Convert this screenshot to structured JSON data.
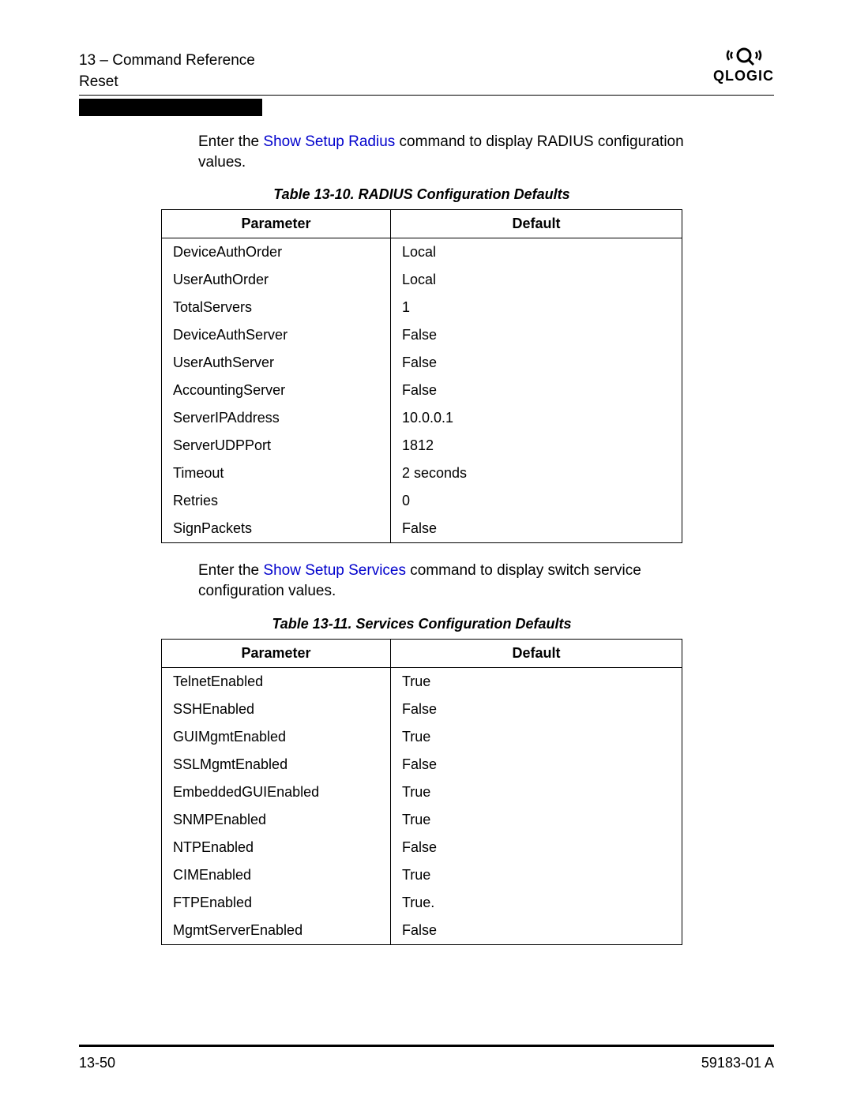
{
  "header": {
    "section": "13 – Command Reference",
    "subsection": "Reset",
    "brand": "QLOGIC"
  },
  "intro1": {
    "pre": "Enter the ",
    "link": "Show Setup Radius",
    "post": " command to display RADIUS configuration values."
  },
  "table1": {
    "caption": "Table 13-10. RADIUS Configuration Defaults",
    "head_param": "Parameter",
    "head_default": "Default"
  },
  "intro2": {
    "pre": "Enter the ",
    "link": "Show Setup Services",
    "post": " command to display switch service configuration values."
  },
  "table2": {
    "caption": "Table 13-11. Services Configuration Defaults",
    "head_param": "Parameter",
    "head_default": "Default"
  },
  "footer": {
    "page": "13-50",
    "docid": "59183-01 A"
  },
  "chart_data": [
    {
      "type": "table",
      "title": "Table 13-10. RADIUS Configuration Defaults",
      "columns": [
        "Parameter",
        "Default"
      ],
      "rows": [
        [
          "DeviceAuthOrder",
          "Local"
        ],
        [
          "UserAuthOrder",
          "Local"
        ],
        [
          "TotalServers",
          "1"
        ],
        [
          "DeviceAuthServer",
          "False"
        ],
        [
          "UserAuthServer",
          "False"
        ],
        [
          "AccountingServer",
          "False"
        ],
        [
          "ServerIPAddress",
          "10.0.0.1"
        ],
        [
          "ServerUDPPort",
          "1812"
        ],
        [
          "Timeout",
          "2 seconds"
        ],
        [
          "Retries",
          "0"
        ],
        [
          "SignPackets",
          "False"
        ]
      ]
    },
    {
      "type": "table",
      "title": "Table 13-11. Services Configuration Defaults",
      "columns": [
        "Parameter",
        "Default"
      ],
      "rows": [
        [
          "TelnetEnabled",
          "True"
        ],
        [
          "SSHEnabled",
          "False"
        ],
        [
          "GUIMgmtEnabled",
          "True"
        ],
        [
          "SSLMgmtEnabled",
          "False"
        ],
        [
          "EmbeddedGUIEnabled",
          "True"
        ],
        [
          "SNMPEnabled",
          "True"
        ],
        [
          "NTPEnabled",
          "False"
        ],
        [
          "CIMEnabled",
          "True"
        ],
        [
          "FTPEnabled",
          "True."
        ],
        [
          "MgmtServerEnabled",
          "False"
        ]
      ]
    }
  ]
}
